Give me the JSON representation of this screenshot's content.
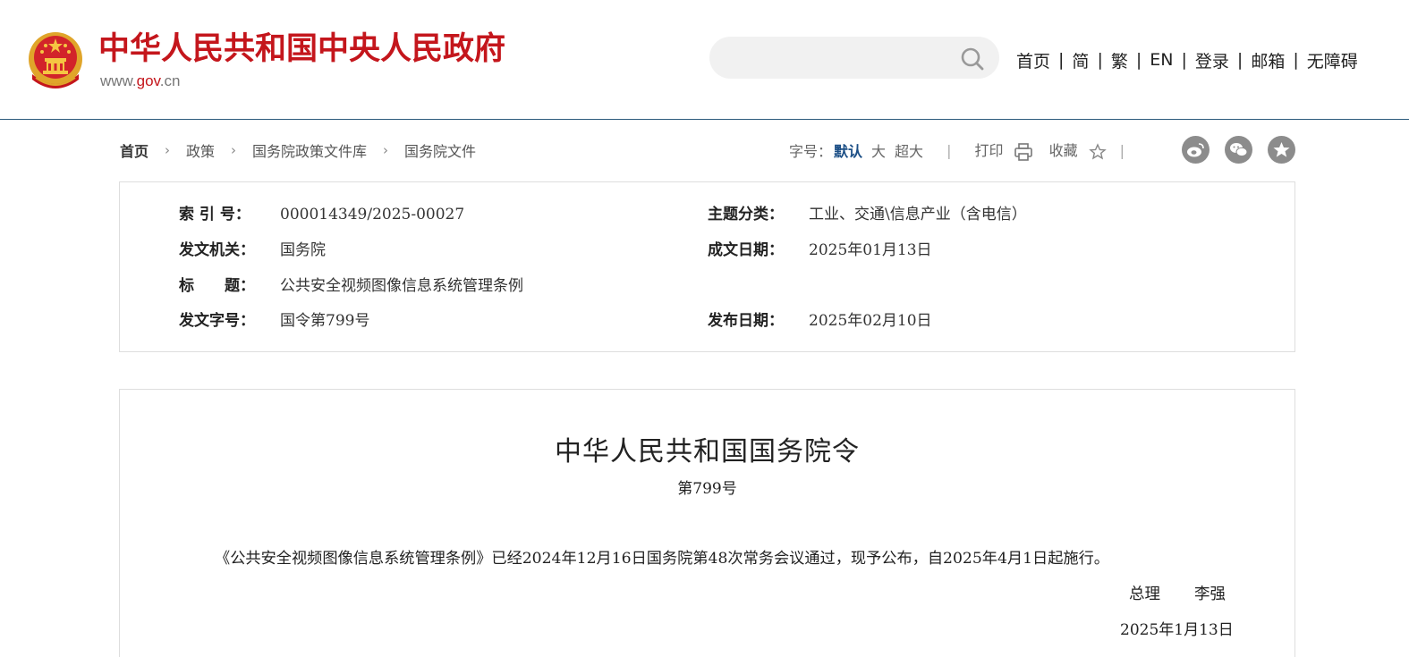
{
  "header": {
    "site_name": "中华人民共和国中央人民政府",
    "site_url_prefix": "www.",
    "site_url_domain": "gov",
    "site_url_suffix": ".cn",
    "search_placeholder": "",
    "nav": [
      "首页",
      "简",
      "繁",
      "EN",
      "登录",
      "邮箱",
      "无障碍"
    ],
    "nav_separator": "|",
    "brand_color": "#c4161c"
  },
  "breadcrumb": {
    "items": [
      "首页",
      "政策",
      "国务院政策文件库",
      "国务院文件"
    ],
    "arrow": "›"
  },
  "tools": {
    "font_size_label": "字号：",
    "font_sizes": [
      "默认",
      "大",
      "超大"
    ],
    "active_font_size": "默认",
    "print_label": "打印",
    "favorite_label": "收藏",
    "divider": "|",
    "share_icons": [
      "weibo-icon",
      "wechat-icon",
      "qzone-star-icon"
    ]
  },
  "meta": {
    "index_no_label": "索 引 号：",
    "index_no": "000014349/2025-00027",
    "topic_label": "主题分类：",
    "topic": "工业、交通\\信息产业（含电信）",
    "issuer_label": "发文机关：",
    "issuer": "国务院",
    "written_date_label": "成文日期：",
    "written_date": "2025年01月13日",
    "title_label": "标　　题：",
    "title": "公共安全视频图像信息系统管理条例",
    "doc_no_label": "发文字号：",
    "doc_no": "国令第799号",
    "publish_date_label": "发布日期：",
    "publish_date": "2025年02月10日"
  },
  "article": {
    "heading": "中华人民共和国国务院令",
    "number": "第799号",
    "body": "《公共安全视频图像信息系统管理条例》已经2024年12月16日国务院第48次常务会议通过，现予公布，自2025年4月1日起施行。",
    "signer_title": "总理",
    "signer_name": "李强",
    "date": "2025年1月13日"
  }
}
